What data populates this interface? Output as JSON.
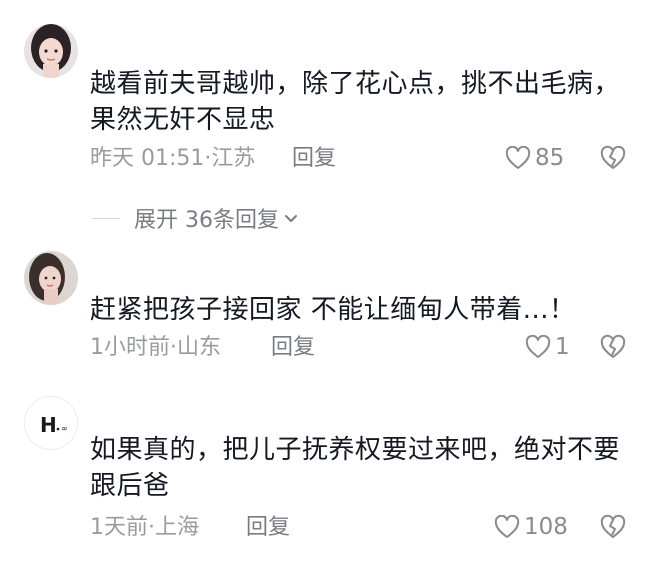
{
  "comments": [
    {
      "text": "越看前夫哥越帅，除了花心点，挑不出毛病，果然无奸不显忠",
      "meta": "昨天 01:51·江苏",
      "reply_label": "回复",
      "likes": "85",
      "expand_label": "展开 36条回复"
    },
    {
      "text": "赶紧把孩子接回家 不能让缅甸人带着...！",
      "meta": "1小时前·山东",
      "reply_label": "回复",
      "likes": "1"
    },
    {
      "text": "如果真的，把儿子抚养权要过来吧，绝对不要跟后爸",
      "meta": "1天前·上海",
      "reply_label": "回复",
      "likes": "108"
    }
  ],
  "icons": {
    "like": "heart-outline-icon",
    "dislike": "broken-heart-outline-icon",
    "expand": "chevron-down-icon"
  },
  "colors": {
    "text": "#161823",
    "meta": "#9a9ba0",
    "action": "#7b7c82"
  }
}
